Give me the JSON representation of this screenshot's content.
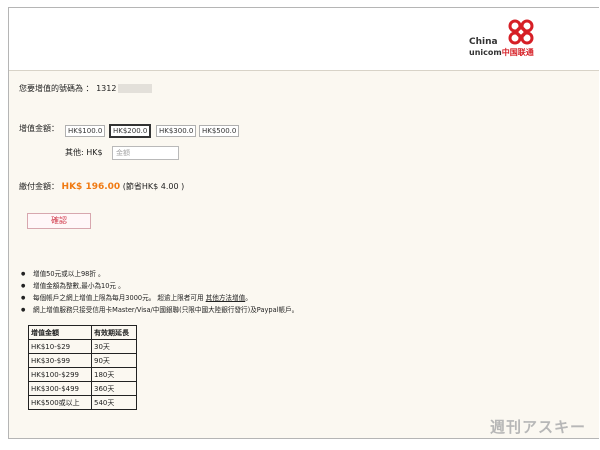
{
  "brand": {
    "name_en_line1": "China",
    "name_en_line2": "unicom",
    "name_cn": "中国联通",
    "accent": "#d61f26"
  },
  "form": {
    "number_label": "您要增值的號碼為 ：",
    "number_value": "1312",
    "amount_label": "增值金額：",
    "amounts": [
      "HK$100.0",
      "HK$200.0",
      "HK$300.0",
      "HK$500.0"
    ],
    "selected_amount": "HK$200.0",
    "other_label": "其他: HK$",
    "other_placeholder": "金額",
    "pay_label": "繳付金額：",
    "pay_amount": "HK$ 196.00",
    "pay_saving": "(節省HK$ 4.00 )",
    "confirm_label": "確認"
  },
  "notes": [
    "增值50元或以上98折 。",
    "增值金額為整數,最小為10元 。",
    "每個帳戶之網上增值上限為每月3000元。 超逾上限者可用",
    "網上增值服務只接受信用卡Master/Visa/中國銀聯(只限中國大陸銀行發行)及Paypal帳戶。"
  ],
  "note_link": "其他方法增值",
  "note_link_suffix": "。",
  "table": {
    "headers": [
      "增值金額",
      "有效期延長"
    ],
    "rows": [
      [
        "HK$10-$29",
        "30天"
      ],
      [
        "HK$30-$99",
        "90天"
      ],
      [
        "HK$100-$299",
        "180天"
      ],
      [
        "HK$300-$499",
        "360天"
      ],
      [
        "HK$500或以上",
        "540天"
      ]
    ]
  },
  "watermark": "週刊アスキー"
}
